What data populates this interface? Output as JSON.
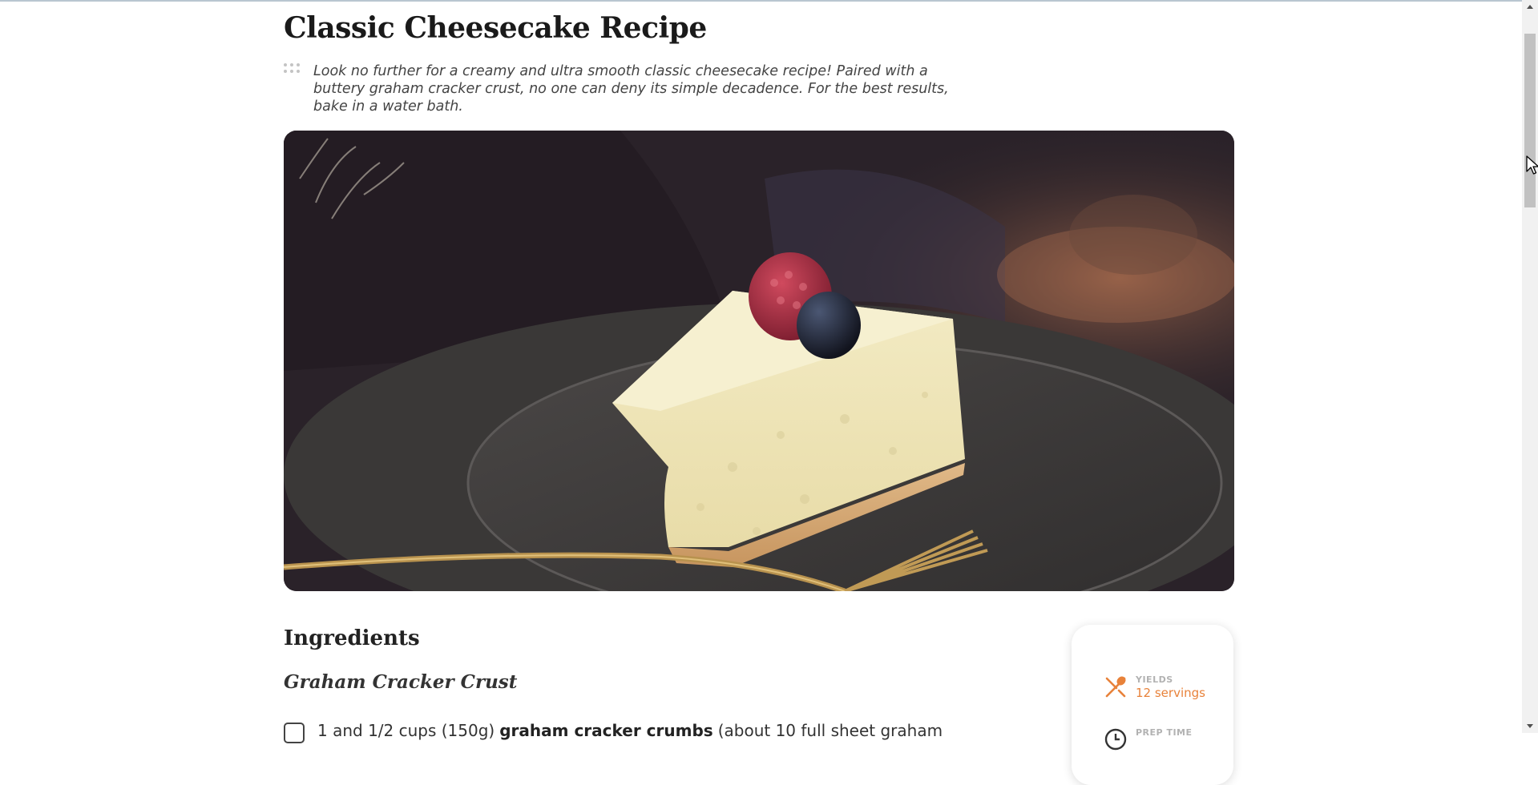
{
  "recipe": {
    "title": "Classic Cheesecake Recipe",
    "intro": "Look no further for a creamy and ultra smooth classic cheesecake recipe! Paired with a buttery graham cracker crust, no one can deny its simple decadence. For the best results, bake in a water bath."
  },
  "hero_image": {
    "description_icon": "cheesecake-photo"
  },
  "ingredients": {
    "heading": "Ingredients",
    "group_title": "Graham Cracker Crust",
    "first_item": {
      "amount": "1 and 1/2 cups (150g)",
      "name": "graham cracker crumbs",
      "note": "(about 10 full sheet graham"
    }
  },
  "info_card": {
    "yields_label": "YIELDS",
    "yields_value": "12 servings",
    "prep_label": "PREP TIME"
  },
  "colors": {
    "accent": "#e8823a",
    "label_gray": "#b2b2b2"
  }
}
